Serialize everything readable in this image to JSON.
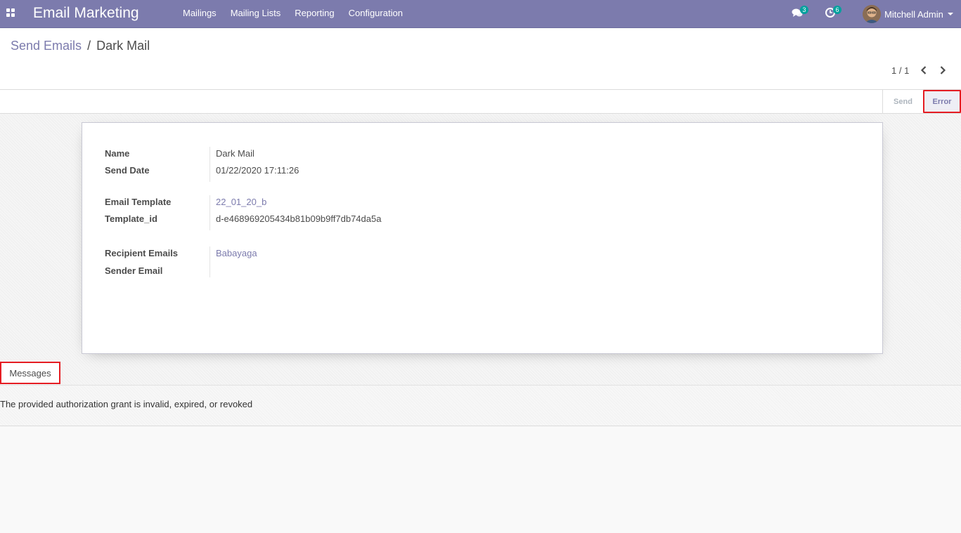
{
  "navbar": {
    "app_title": "Email Marketing",
    "menu": [
      "Mailings",
      "Mailing Lists",
      "Reporting",
      "Configuration"
    ],
    "messages_count": "3",
    "activities_count": "6",
    "user_name": "Mitchell Admin",
    "color": "#7c7bad"
  },
  "breadcrumb": {
    "parent": "Send Emails",
    "separator": "/",
    "current": "Dark Mail"
  },
  "pager": {
    "value": "1 / 1"
  },
  "status": {
    "send": "Send",
    "error": "Error",
    "active": "error"
  },
  "form": {
    "name_label": "Name",
    "name_value": "Dark Mail",
    "send_date_label": "Send Date",
    "send_date_value": "01/22/2020 17:11:26",
    "email_template_label": "Email Template",
    "email_template_value": "22_01_20_b",
    "template_id_label": "Template_id",
    "template_id_value": "d-e468969205434b81b09b9ff7db74da5a",
    "recipient_label": "Recipient Emails",
    "recipient_value": "Babayaga",
    "sender_label": "Sender Email",
    "sender_value": ""
  },
  "messages": {
    "tab_label": "Messages",
    "text": "The provided authorization grant is invalid, expired, or revoked"
  }
}
